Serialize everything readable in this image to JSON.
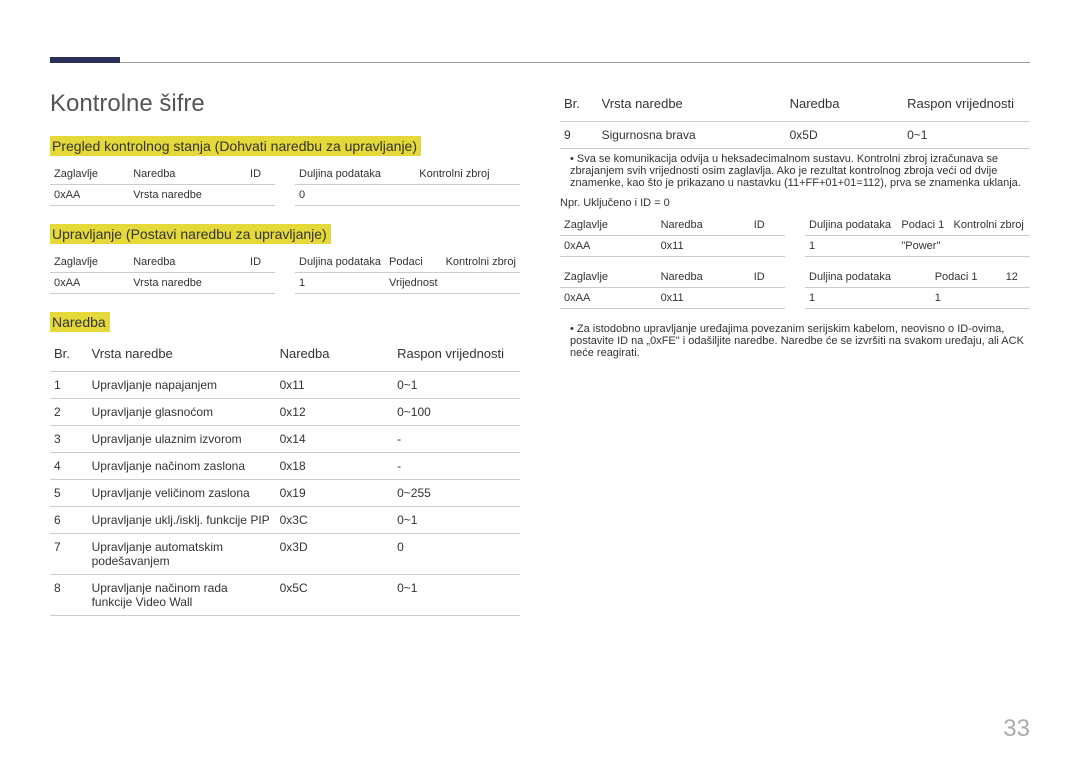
{
  "page_number": "33",
  "title": "Kontrolne šifre",
  "left": {
    "section1": {
      "heading": "Pregled kontrolnog stanja (Dohvati naredbu za upravljanje)",
      "grid": {
        "row1": [
          "Zaglavlje",
          "Naredba",
          "ID",
          "Duljina podataka",
          "Kontrolni zbroj"
        ],
        "row2": [
          "0xAA",
          "Vrsta naredbe",
          "",
          "0",
          ""
        ]
      }
    },
    "section2": {
      "heading": "Upravljanje (Postavi naredbu za upravljanje)",
      "grid": {
        "row1": [
          "Zaglavlje",
          "Naredba",
          "ID",
          "Duljina podataka",
          "Podaci",
          "Kontrolni zbroj"
        ],
        "row2": [
          "0xAA",
          "Vrsta naredbe",
          "",
          "1",
          "Vrijednost",
          ""
        ]
      }
    },
    "section3": {
      "heading": "Naredba",
      "headers": [
        "Br.",
        "Vrsta naredbe",
        "Naredba",
        "Raspon vrijednosti"
      ],
      "rows": [
        {
          "n": "1",
          "type": "Upravljanje napajanjem",
          "cmd": "0x11",
          "range": "0~1"
        },
        {
          "n": "2",
          "type": "Upravljanje glasnoćom",
          "cmd": "0x12",
          "range": "0~100"
        },
        {
          "n": "3",
          "type": "Upravljanje ulaznim izvorom",
          "cmd": "0x14",
          "range": "-"
        },
        {
          "n": "4",
          "type": "Upravljanje načinom zaslona",
          "cmd": "0x18",
          "range": "-"
        },
        {
          "n": "5",
          "type": "Upravljanje veličinom zaslona",
          "cmd": "0x19",
          "range": "0~255"
        },
        {
          "n": "6",
          "type": "Upravljanje uklj./isklj. funkcije PIP",
          "cmd": "0x3C",
          "range": "0~1"
        },
        {
          "n": "7",
          "type": "Upravljanje automatskim podešavanjem",
          "cmd": "0x3D",
          "range": "0"
        },
        {
          "n": "8",
          "type": "Upravljanje načinom rada funkcije Video Wall",
          "cmd": "0x5C",
          "range": "0~1"
        }
      ]
    }
  },
  "right": {
    "headers": [
      "Br.",
      "Vrsta naredbe",
      "Naredba",
      "Raspon vrijednosti"
    ],
    "row9": {
      "n": "9",
      "type": "Sigurnosna brava",
      "cmd": "0x5D",
      "range": "0~1"
    },
    "note1": "• Sva se komunikacija odvija u heksadecimalnom sustavu. Kontrolni zbroj izračunava se zbrajanjem svih vrijednosti osim zaglavlja. Ako je rezultat kontrolnog zbroja veći od dvije znamenke, kao što je prikazano u nastavku (11+FF+01+01=112), prva se znamenka uklanja.",
    "example_label": "Npr. Uključeno i ID = 0",
    "ex_tbl_a": {
      "row1": [
        "Zaglavlje",
        "Naredba",
        "ID",
        "Duljina podataka",
        "Podaci 1",
        "Kontrolni zbroj"
      ],
      "row2": [
        "0xAA",
        "0x11",
        "",
        "1",
        "\"Power\"",
        ""
      ]
    },
    "ex_tbl_b": {
      "row1": [
        "Zaglavlje",
        "Naredba",
        "ID",
        "Duljina podataka",
        "Podaci 1",
        "12"
      ],
      "row2": [
        "0xAA",
        "0x11",
        "",
        "1",
        "1",
        ""
      ]
    },
    "note2": "• Za istodobno upravljanje uređajima povezanim serijskim kabelom, neovisno o ID-ovima, postavite ID na „0xFE\" i odašiljite naredbe. Naredbe će se izvršiti na svakom uređaju, ali ACK neće reagirati."
  }
}
